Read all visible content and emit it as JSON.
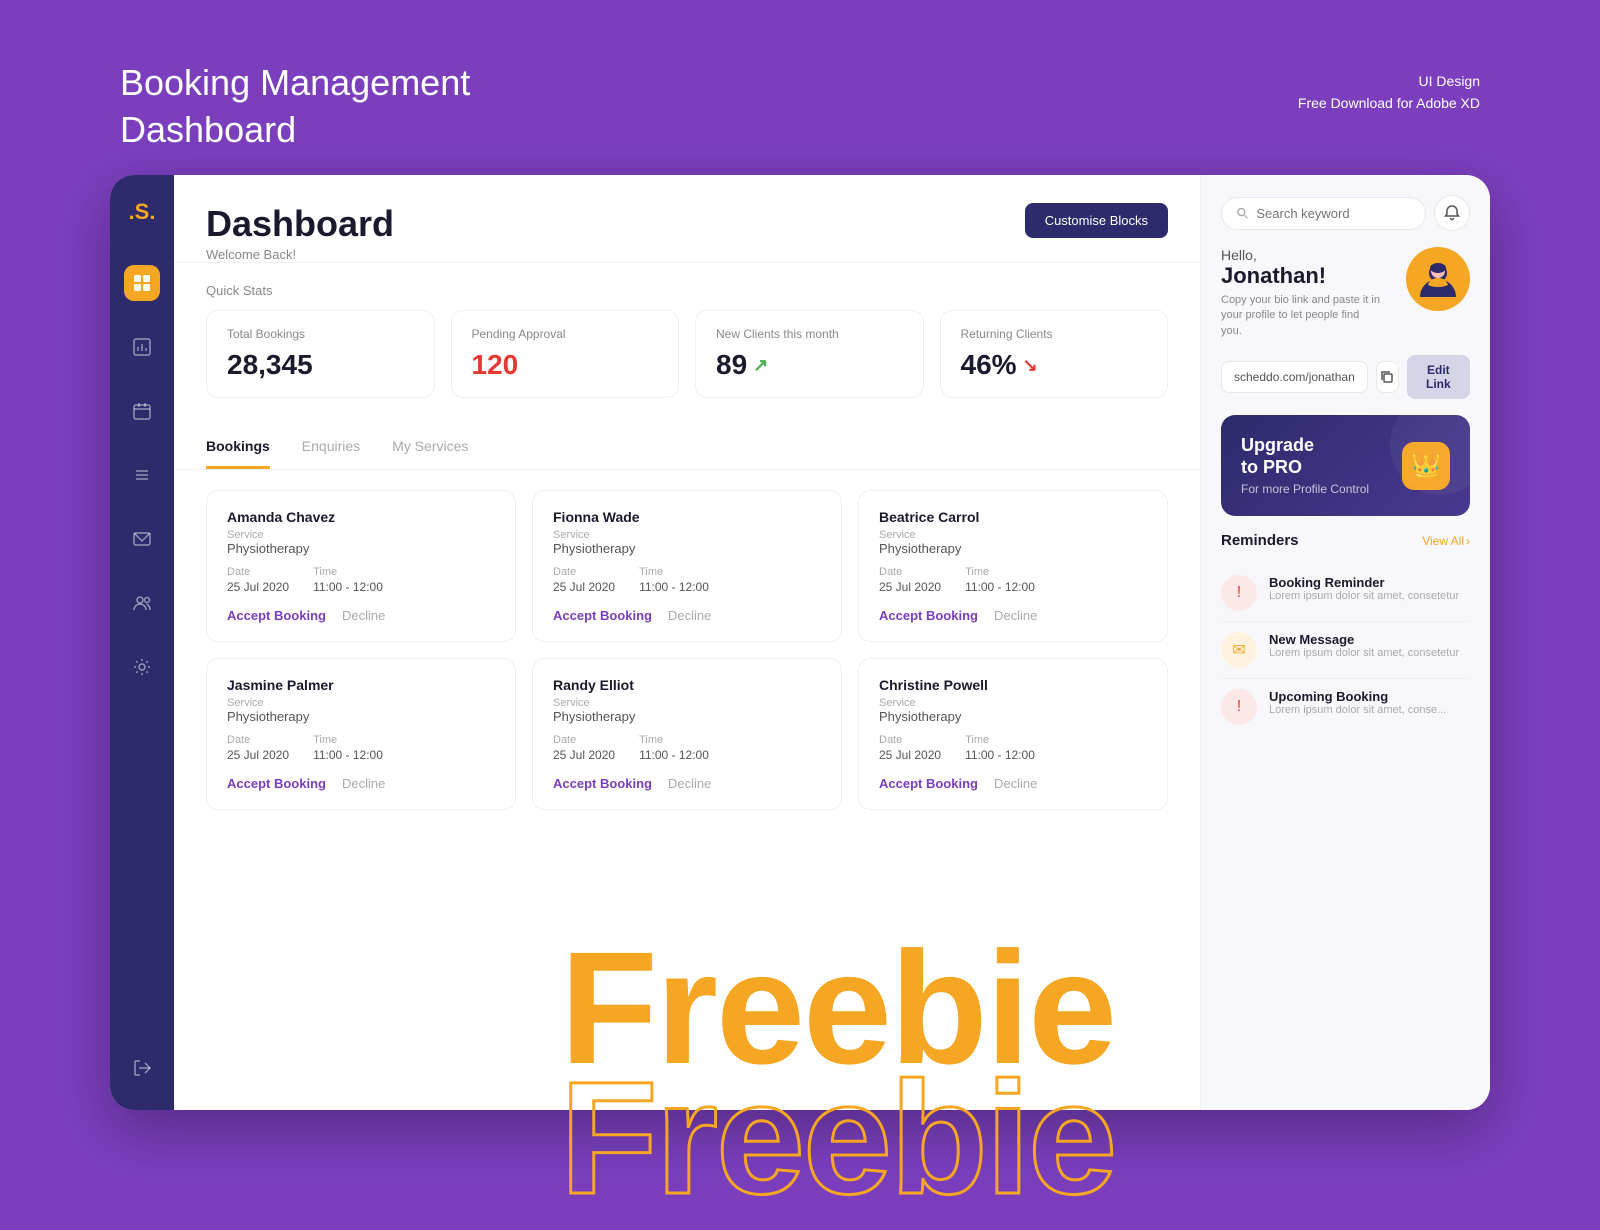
{
  "page": {
    "bg_title_line1": "Booking Management",
    "bg_title_line2": "Dashboard",
    "bg_subtitle_line1": "UI Design",
    "bg_subtitle_line2": "Free Download for Adobe XD",
    "freebie_solid": "Freebie",
    "freebie_outline": "Freebie"
  },
  "sidebar": {
    "logo": ".S.",
    "items": [
      {
        "icon": "⊞",
        "active": true,
        "name": "dashboard"
      },
      {
        "icon": "▦",
        "active": false,
        "name": "analytics"
      },
      {
        "icon": "▤",
        "active": false,
        "name": "calendar"
      },
      {
        "icon": "☰",
        "active": false,
        "name": "list"
      },
      {
        "icon": "✉",
        "active": false,
        "name": "messages"
      },
      {
        "icon": "👥",
        "active": false,
        "name": "clients"
      },
      {
        "icon": "⚙",
        "active": false,
        "name": "settings"
      }
    ],
    "logout_icon": "⇥"
  },
  "header": {
    "title": "Dashboard",
    "welcome": "Welcome Back!",
    "customise_button": "Customise Blocks"
  },
  "quick_stats": {
    "section_title": "Quick Stats",
    "cards": [
      {
        "label": "Total Bookings",
        "value": "28,345",
        "trend": ""
      },
      {
        "label": "Pending Approval",
        "value": "120",
        "trend": ""
      },
      {
        "label": "New Clients this month",
        "value": "89",
        "trend": "up"
      },
      {
        "label": "Returning Clients",
        "value": "46%",
        "trend": "down"
      }
    ]
  },
  "tabs": [
    {
      "label": "Bookings",
      "active": true
    },
    {
      "label": "Enquiries",
      "active": false
    },
    {
      "label": "My Services",
      "active": false
    }
  ],
  "bookings": [
    {
      "name": "Amanda Chavez",
      "service_label": "Service",
      "service": "Physiotherapy",
      "date_label": "Date",
      "date": "25 Jul 2020",
      "time_label": "Time",
      "time": "11:00 - 12:00",
      "accept_label": "Accept Booking",
      "decline_label": "Decline"
    },
    {
      "name": "Fionna Wade",
      "service_label": "Service",
      "service": "Physiotherapy",
      "date_label": "Date",
      "date": "25 Jul 2020",
      "time_label": "Time",
      "time": "11:00 - 12:00",
      "accept_label": "Accept Booking",
      "decline_label": "Decline"
    },
    {
      "name": "Beatrice Carrol",
      "service_label": "Service",
      "service": "Physiotherapy",
      "date_label": "Date",
      "date": "25 Jul 2020",
      "time_label": "Time",
      "time": "11:00 - 12:00",
      "accept_label": "Accept Booking",
      "decline_label": "Decline"
    },
    {
      "name": "Jasmine Palmer",
      "service_label": "Service",
      "service": "Physiotherapy",
      "date_label": "Date",
      "date": "25 Jul 2020",
      "time_label": "Time",
      "time": "11:00 - 12:00",
      "accept_label": "Accept Booking",
      "decline_label": "Decline"
    },
    {
      "name": "Randy Elliot",
      "service_label": "Service",
      "service": "Physiotherapy",
      "date_label": "Date",
      "date": "25 Jul 2020",
      "time_label": "Time",
      "time": "11:00 - 12:00",
      "accept_label": "Accept Booking",
      "decline_label": "Decline"
    },
    {
      "name": "Christine Powell",
      "service_label": "Service",
      "service": "Physiotherapy",
      "date_label": "Date",
      "date": "25 Jul 2020",
      "time_label": "Time",
      "time": "11:00 - 12:00",
      "accept_label": "Accept Booking",
      "decline_label": "Decline"
    }
  ],
  "right_panel": {
    "search_placeholder": "Search keyword",
    "profile": {
      "hello": "Hello,",
      "name": "Jonathan!",
      "bio_text": "Copy your bio link and paste it in your profile to let people find you.",
      "link": "scheddo.com/jonathan",
      "copy_tooltip": "Copy",
      "edit_link_label": "Edit Link"
    },
    "upgrade": {
      "title_line1": "Upgrade",
      "title_line2": "to PRO",
      "subtitle": "For more Profile Control",
      "crown": "👑"
    },
    "reminders": {
      "title": "Reminders",
      "view_all": "View All",
      "items": [
        {
          "type": "red",
          "icon": "!",
          "title": "Booking Reminder",
          "subtitle": "Lorem ipsum dolor sit amet, consetetur"
        },
        {
          "type": "yellow",
          "icon": "✉",
          "title": "New Message",
          "subtitle": "Lorem ipsum dolor sit amet, consetetur"
        },
        {
          "type": "red",
          "icon": "!",
          "title": "Upcoming Booking",
          "subtitle": "Lorem ipsum dolor sit amet, conse..."
        }
      ]
    }
  }
}
